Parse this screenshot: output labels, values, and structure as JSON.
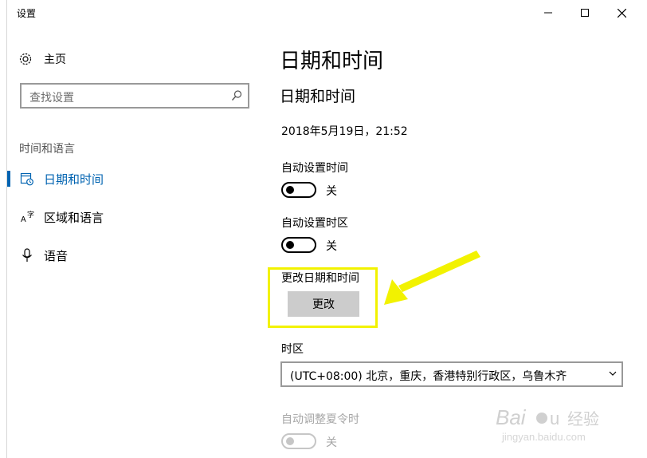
{
  "window": {
    "title": "设置"
  },
  "nav": {
    "home_label": "主页",
    "search_placeholder": "查找设置",
    "section_label": "时间和语言",
    "items": [
      {
        "label": "日期和时间",
        "icon": "calendar-clock-icon",
        "active": true
      },
      {
        "label": "区域和语言",
        "icon": "region-language-icon",
        "active": false
      },
      {
        "label": "语音",
        "icon": "microphone-icon",
        "active": false
      }
    ]
  },
  "main": {
    "page_title": "日期和时间",
    "section_title": "日期和时间",
    "current_datetime": "2018年5月19日，21:52",
    "auto_time": {
      "label": "自动设置时间",
      "state": "关"
    },
    "auto_timezone": {
      "label": "自动设置时区",
      "state": "关"
    },
    "change_datetime": {
      "label": "更改日期和时间",
      "button": "更改"
    },
    "timezone": {
      "label": "时区",
      "value": "(UTC+08:00) 北京，重庆，香港特别行政区，乌鲁木齐"
    },
    "dst": {
      "label": "自动调整夏令时",
      "state": "关",
      "disabled": true
    }
  },
  "annotation": {
    "highlight_color": "#f2f200",
    "arrow_color": "#f2f200"
  },
  "colors": {
    "accent": "#0063b1"
  }
}
